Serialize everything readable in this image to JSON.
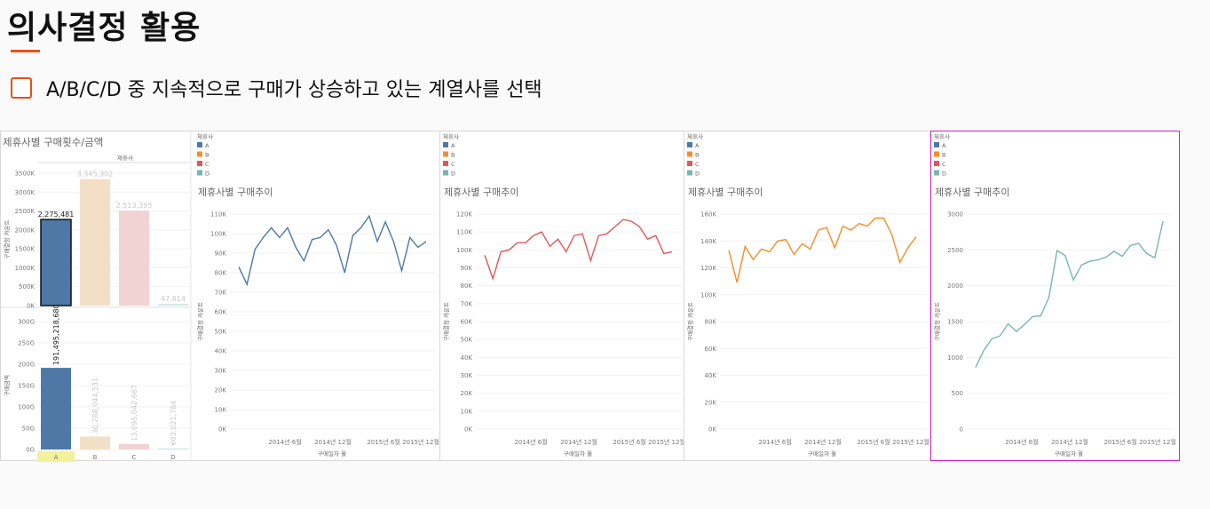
{
  "page": {
    "title": "의사결정 활용",
    "checkbox_text": "A/B/C/D 중 지속적으로 구매가 상승하고 있는 계열사를 선택"
  },
  "colors": {
    "accent": "#e8501a",
    "A": "#4e79a7",
    "B": "#f28e2b",
    "C": "#e15759",
    "D": "#76b7b2",
    "highlight": "#d01fd0"
  },
  "chart_data": [
    {
      "type": "bar",
      "title": "제휴사별 구매횟수/금액",
      "legend_title": "제휴사",
      "categories": [
        "A",
        "B",
        "C",
        "D"
      ],
      "series": [
        {
          "ylabel": "구매결정 카운트",
          "ticks": [
            "3500K",
            "3000K",
            "2500K",
            "2000K",
            "1500K",
            "1000K",
            "500K",
            "0K"
          ],
          "ylim": [
            0,
            3500000
          ],
          "values": [
            2275481,
            3345302,
            2513395,
            47814
          ],
          "labels": [
            "2,275,481",
            "3,345,302",
            "2,513,395",
            "47,814"
          ]
        },
        {
          "ylabel": "구매금액",
          "ticks": [
            "300G",
            "250G",
            "200G",
            "150G",
            "100G",
            "50G",
            "0G"
          ],
          "ylim": [
            0,
            300000000000
          ],
          "values": [
            191495218680,
            30288044531,
            13095042667,
            603021784
          ],
          "labels": [
            "191,495,218,680",
            "30,288,044,531",
            "13,095,042,667",
            "603,021,784"
          ]
        }
      ],
      "selected": "A"
    },
    {
      "type": "line",
      "title": "제휴사별 구매추이",
      "xlabel": "구매일자 월",
      "ylabel": "구매결정 카운트",
      "legend_title": "제휴사",
      "legend": [
        "A",
        "B",
        "C",
        "D"
      ],
      "color": "#4e79a7",
      "ticks": [
        "110K",
        "100K",
        "90K",
        "80K",
        "70K",
        "60K",
        "50K",
        "40K",
        "30K",
        "20K",
        "10K",
        "0K"
      ],
      "ylim": [
        0,
        115000
      ],
      "xticks": [
        "2014년 6월",
        "2014년 12월",
        "2015년 6월",
        "2015년 12월"
      ],
      "values": [
        83000,
        74000,
        92000,
        98000,
        103000,
        98000,
        103000,
        93000,
        86000,
        97000,
        98000,
        102000,
        94000,
        80000,
        99000,
        103000,
        109000,
        96000,
        106000,
        96000,
        81000,
        98000,
        93000,
        96000
      ]
    },
    {
      "type": "line",
      "title": "제휴사별 구매추이",
      "xlabel": "구매일자 월",
      "ylabel": "구매결정 카운트",
      "legend_title": "제휴사",
      "legend": [
        "A",
        "B",
        "C",
        "D"
      ],
      "color": "#e15759",
      "ticks": [
        "120K",
        "110K",
        "100K",
        "90K",
        "80K",
        "70K",
        "60K",
        "50K",
        "40K",
        "30K",
        "20K",
        "10K",
        "0K"
      ],
      "ylim": [
        0,
        125000
      ],
      "xticks": [
        "2014년 6월",
        "2014년 12월",
        "2015년 6월",
        "2015년 12월"
      ],
      "values": [
        97000,
        84000,
        99000,
        100000,
        104000,
        104000,
        108000,
        110000,
        102000,
        106000,
        99000,
        108000,
        109000,
        94000,
        108000,
        109000,
        113000,
        117000,
        116000,
        113000,
        106000,
        108000,
        98000,
        99000
      ]
    },
    {
      "type": "line",
      "title": "제휴사별 구매추이",
      "xlabel": "구매일자 월",
      "ylabel": "구매결정 카운트",
      "legend_title": "제휴사",
      "legend": [
        "A",
        "B",
        "C",
        "D"
      ],
      "color": "#f28e2b",
      "ticks": [
        "160K",
        "140K",
        "120K",
        "100K",
        "80K",
        "60K",
        "40K",
        "20K",
        "0K"
      ],
      "ylim": [
        0,
        165000
      ],
      "xticks": [
        "2014년 6월",
        "2014년 12월",
        "2015년 6월",
        "2015년 12월"
      ],
      "values": [
        133000,
        109000,
        136000,
        126000,
        134000,
        132000,
        140000,
        141000,
        130000,
        138000,
        134000,
        148000,
        150000,
        135000,
        151000,
        148000,
        153000,
        151000,
        157000,
        157000,
        145000,
        124000,
        135000,
        143000
      ]
    },
    {
      "type": "line",
      "title": "제휴사별 구매추이",
      "xlabel": "구매일자 월",
      "ylabel": "구매결정 카운트",
      "legend_title": "제휴사",
      "legend": [
        "A",
        "B",
        "C",
        "D"
      ],
      "color": "#76b7b2",
      "ticks": [
        "3000",
        "2500",
        "2000",
        "1500",
        "1000",
        "500",
        "0"
      ],
      "ylim": [
        0,
        3000
      ],
      "xticks": [
        "2014년 6월",
        "2014년 12월",
        "2015년 6월",
        "2015년 12월"
      ],
      "values": [
        860,
        1100,
        1260,
        1300,
        1470,
        1360,
        1460,
        1570,
        1580,
        1840,
        2490,
        2420,
        2080,
        2290,
        2340,
        2360,
        2400,
        2480,
        2410,
        2560,
        2590,
        2450,
        2390,
        2900
      ]
    }
  ]
}
